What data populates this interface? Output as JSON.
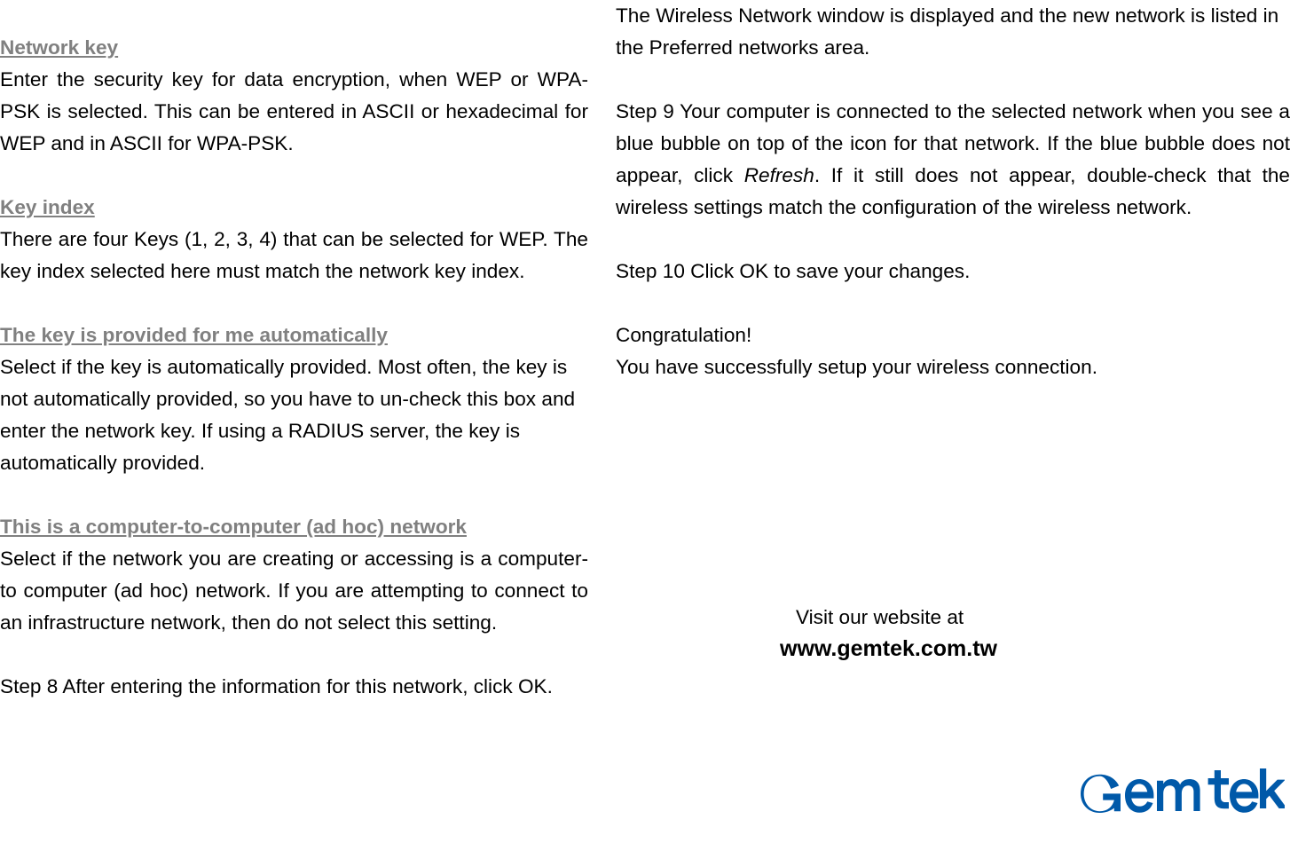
{
  "left": {
    "h_network_key": "Network key",
    "p_network_key": "Enter the security key for data encryption, when WEP or WPA-PSK is selected. This can be entered in ASCII or hexadecimal for WEP and in ASCII for WPA-PSK.",
    "h_key_index": "Key index",
    "p_key_index": "There are four Keys (1, 2, 3, 4) that can be selected for WEP. The key index selected here must match the network key index.",
    "h_auto_key": "The key is provided for me automatically  ",
    "p_auto_key": "Select if the key is automatically provided. Most often, the key is not automatically provided, so you have to un-check this box and enter the network key. If using a RADIUS server, the key is automatically provided.",
    "h_adhoc": "This is a computer-to-computer (ad hoc) network",
    "p_adhoc": "Select if the network you are creating or accessing is a computer-to computer (ad hoc) network. If you are attempting to connect to an infrastructure network, then do not select this setting.",
    "step8": "Step 8    After entering the information for this network, click OK."
  },
  "right": {
    "p_preferred": "The Wireless Network window is displayed and the new network is listed in the Preferred networks area.",
    "step9_a": "Step 9   Your computer is connected to the selected network when you see a blue bubble on top of the icon for that network. If the blue bubble does not appear, click ",
    "step9_refresh": "Refresh",
    "step9_b": ". If it still does not appear, double-check that the wireless settings match the configuration of the wireless network.",
    "step10": "Step 10    Click OK to save your changes.",
    "congrats": "Congratulation!",
    "success": "You have successfully setup your wireless connection.",
    "visit": "Visit our website at",
    "url": "www.gemtek.com.tw"
  },
  "logo": {
    "text": "Gemtek",
    "color": "#0059a9"
  }
}
